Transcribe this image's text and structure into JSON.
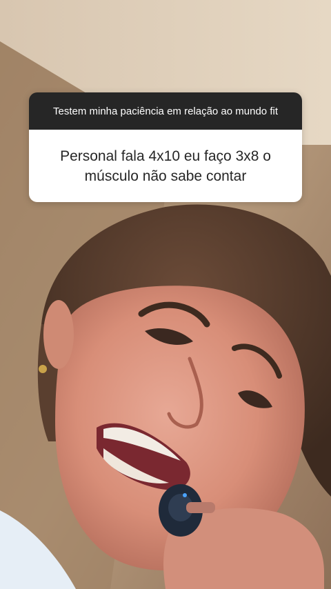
{
  "question_sticker": {
    "prompt": "Testem minha paciência em relação ao mundo fit",
    "answer": "Personal fala 4x10 eu faço 3x8 o músculo não sabe contar",
    "header_color": "#262626",
    "body_color": "#ffffff"
  },
  "photo": {
    "subject": "woman grimacing while holding a small dark object near her mouth",
    "background_colors": [
      "#d9c5ad",
      "#a88a6c",
      "#7a5e48"
    ]
  }
}
